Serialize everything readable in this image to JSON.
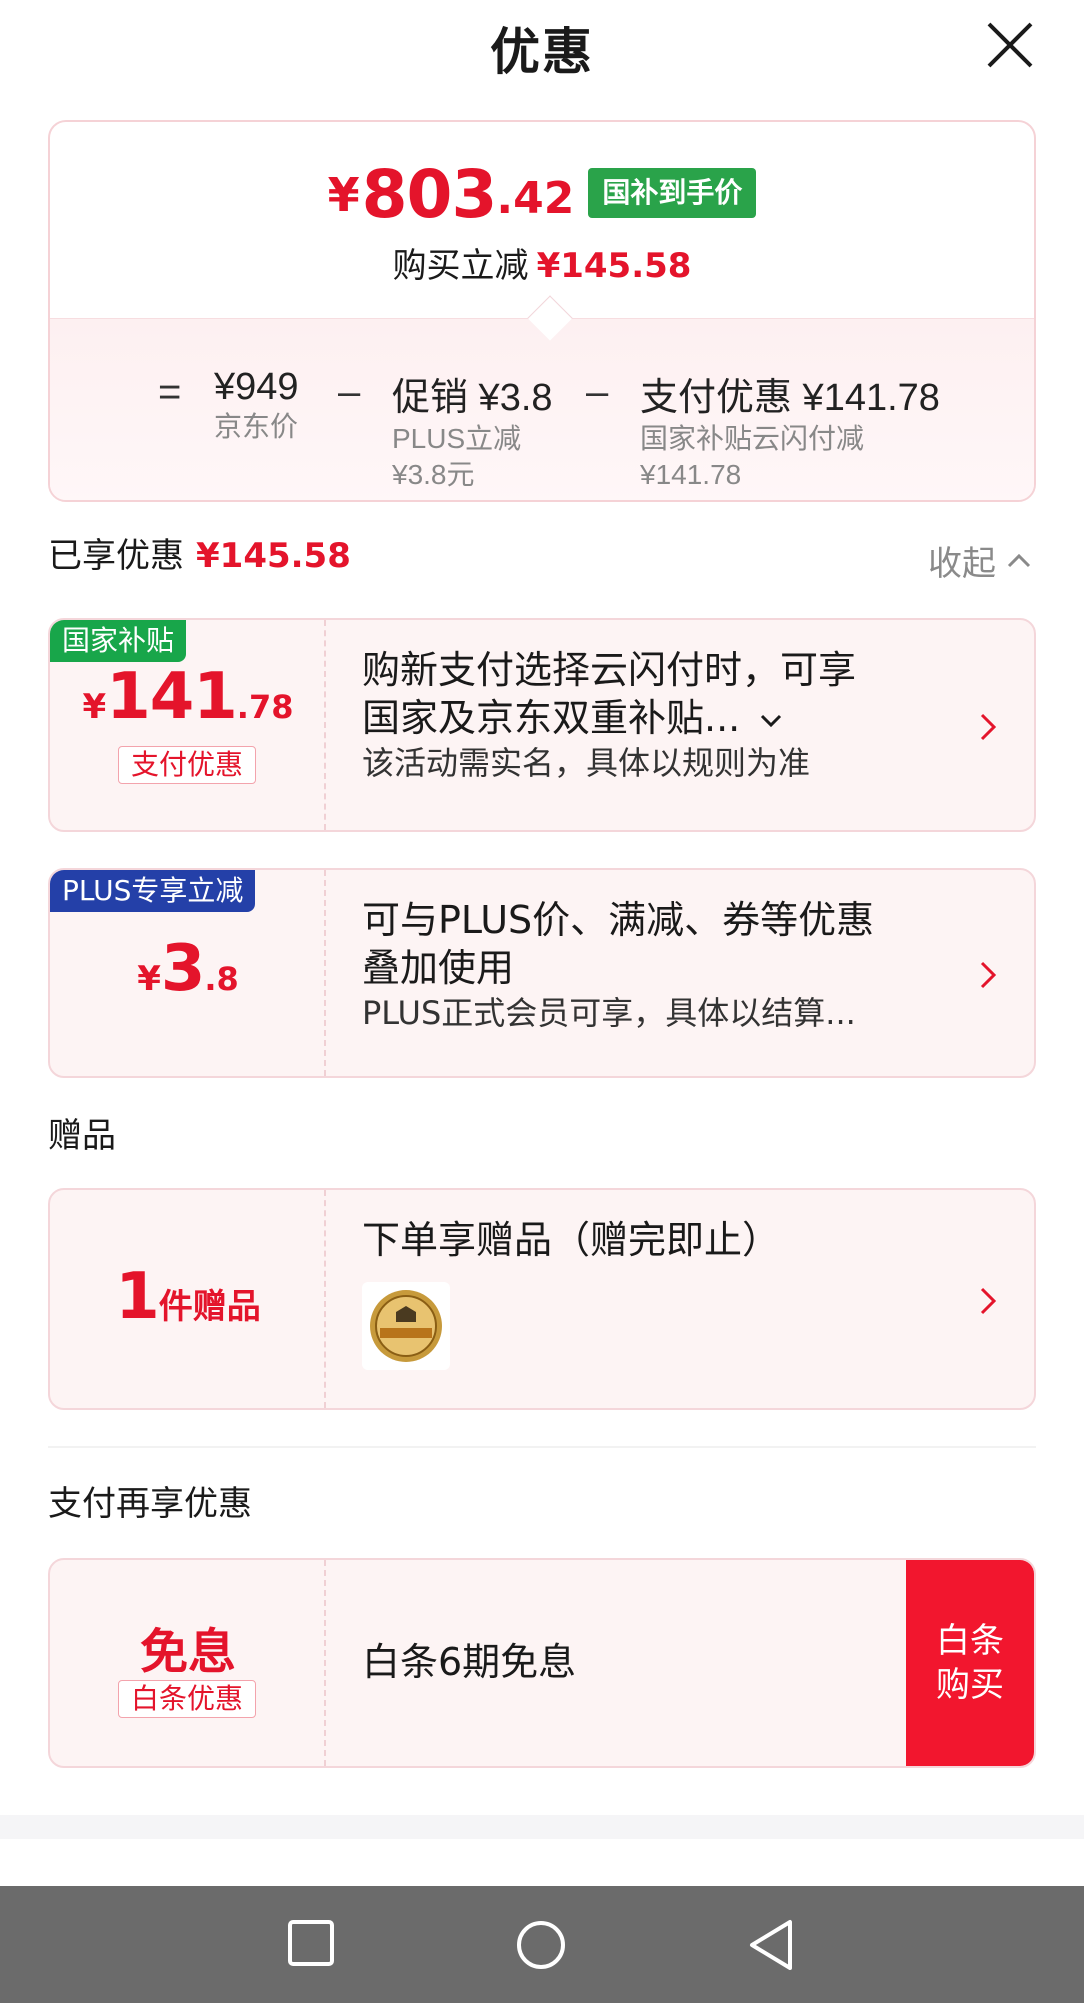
{
  "header": {
    "title": "优惠"
  },
  "summary": {
    "final_price": {
      "yen": "¥",
      "int": "803",
      "dec": ".42"
    },
    "badge": "国补到手价",
    "reduce_label": "购买立减",
    "reduce_amount": "¥145.58",
    "formula": {
      "eq": "=",
      "jd_price": {
        "value": "¥949",
        "label": "京东价"
      },
      "minus1": "–",
      "promo": {
        "value": "促销 ¥3.8",
        "sub1": "PLUS立减",
        "sub2": "¥3.8元"
      },
      "minus2": "–",
      "pay": {
        "value": "支付优惠 ¥141.78",
        "sub1": "国家补贴云闪付减",
        "sub2": "¥141.78"
      }
    }
  },
  "enjoyed": {
    "label": "已享优惠",
    "amount": "¥145.58",
    "collapse": "收起"
  },
  "offers": [
    {
      "tag": "国家补贴",
      "yen": "¥",
      "big": "141",
      "dec": ".78",
      "sublabel": "支付优惠",
      "desc_line1": "购新支付选择云闪付时，可享",
      "desc_line2": "国家及京东双重补贴...",
      "note": "该活动需实名，具体以规则为准"
    },
    {
      "tag": "PLUS专享立减",
      "yen": "¥",
      "big": "3",
      "dec": ".8",
      "desc_line1": "可与PLUS价、满减、券等优惠",
      "desc_line2": "叠加使用",
      "note": "PLUS正式会员可享，具体以结算..."
    }
  ],
  "gift_section": {
    "label": "赠品",
    "count": "1",
    "unit": "件赠品",
    "desc": "下单享赠品（赠完即止）"
  },
  "pay_section": {
    "label": "支付再享优惠",
    "title": "免息",
    "sublabel": "白条优惠",
    "desc": "白条6期免息",
    "button": "白条\n购买",
    "button_line1": "白条",
    "button_line2": "购买"
  },
  "colors": {
    "accent": "#e4142b",
    "green": "#18a64a",
    "blue": "#2440a8",
    "button": "#f2162e"
  },
  "icons": [
    "close-icon",
    "chevron-up-icon",
    "chevron-down-icon",
    "chevron-right-icon",
    "square-nav-icon",
    "circle-nav-icon",
    "back-nav-icon"
  ]
}
